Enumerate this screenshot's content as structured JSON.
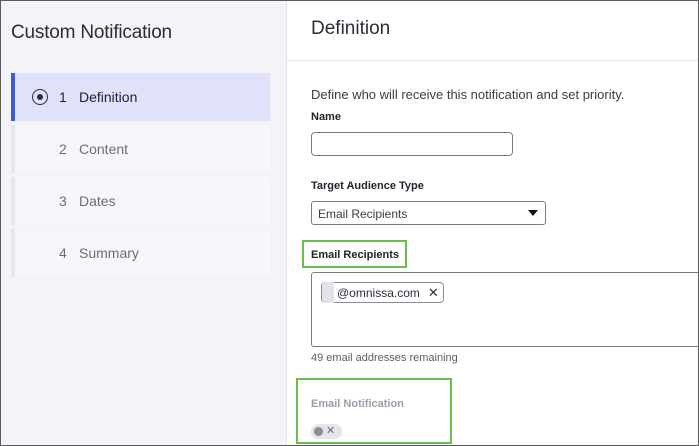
{
  "sidebar": {
    "title": "Custom Notification",
    "steps": [
      {
        "num": "1",
        "label": "Definition",
        "active": true
      },
      {
        "num": "2",
        "label": "Content",
        "active": false
      },
      {
        "num": "3",
        "label": "Dates",
        "active": false
      },
      {
        "num": "4",
        "label": "Summary",
        "active": false
      }
    ]
  },
  "main": {
    "title": "Definition",
    "description": "Define who will receive this notification and set priority.",
    "name": {
      "label": "Name",
      "value": ""
    },
    "audience": {
      "label": "Target Audience Type",
      "selected": "Email Recipients"
    },
    "recipients": {
      "label": "Email Recipients",
      "chips": [
        {
          "text": "@omnissa.com",
          "remove_icon": "close-icon"
        }
      ],
      "remaining": "49 email addresses remaining"
    },
    "email_notification": {
      "label": "Email Notification",
      "enabled": false,
      "icon": "x-icon"
    }
  },
  "colors": {
    "accent": "#3b5bd9",
    "highlight": "#6cbc4c",
    "active_step_bg": "#dfe2f8"
  }
}
